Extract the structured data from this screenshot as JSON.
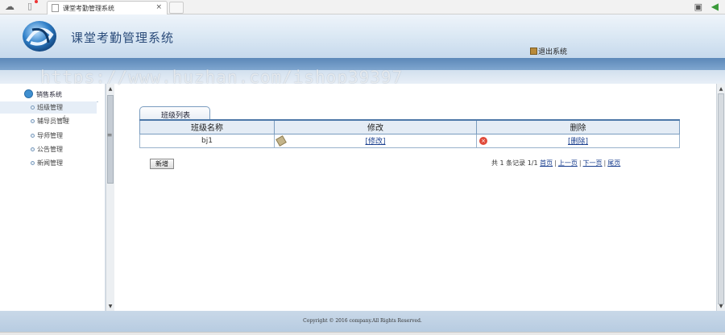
{
  "browser": {
    "tab_title": "课堂考勤管理系统",
    "tab_close": "×"
  },
  "header": {
    "app_title": "课堂考勤管理系统",
    "logout_label": "退出系统"
  },
  "watermark": "https://www.huzhan.com/ishop39397",
  "sidebar": {
    "group_label": "销售系统",
    "items": [
      {
        "label": "班级管理",
        "active": true
      },
      {
        "label": "辅导员管理"
      },
      {
        "label": "导师管理"
      },
      {
        "label": "公告管理"
      },
      {
        "label": "新闻管理"
      }
    ]
  },
  "list": {
    "caption": "班级列表",
    "columns": [
      "班级名称",
      "修改",
      "删除"
    ],
    "rows": [
      {
        "name": "bj1",
        "edit": "[修改]",
        "delete": "[删除]"
      }
    ]
  },
  "actions": {
    "add_label": "新增"
  },
  "pager": {
    "summary": "共 1 条记录 1/1",
    "first": "首页",
    "prev": "上一页",
    "next": "下一页",
    "last": "尾页",
    "sep": "|"
  },
  "footer": {
    "copyright": "Copyright © 2016 company.All Rights Reserved."
  },
  "colors": {
    "accent": "#4d78a8",
    "header_band": "#5c88b8",
    "link": "#1a3f8f"
  }
}
